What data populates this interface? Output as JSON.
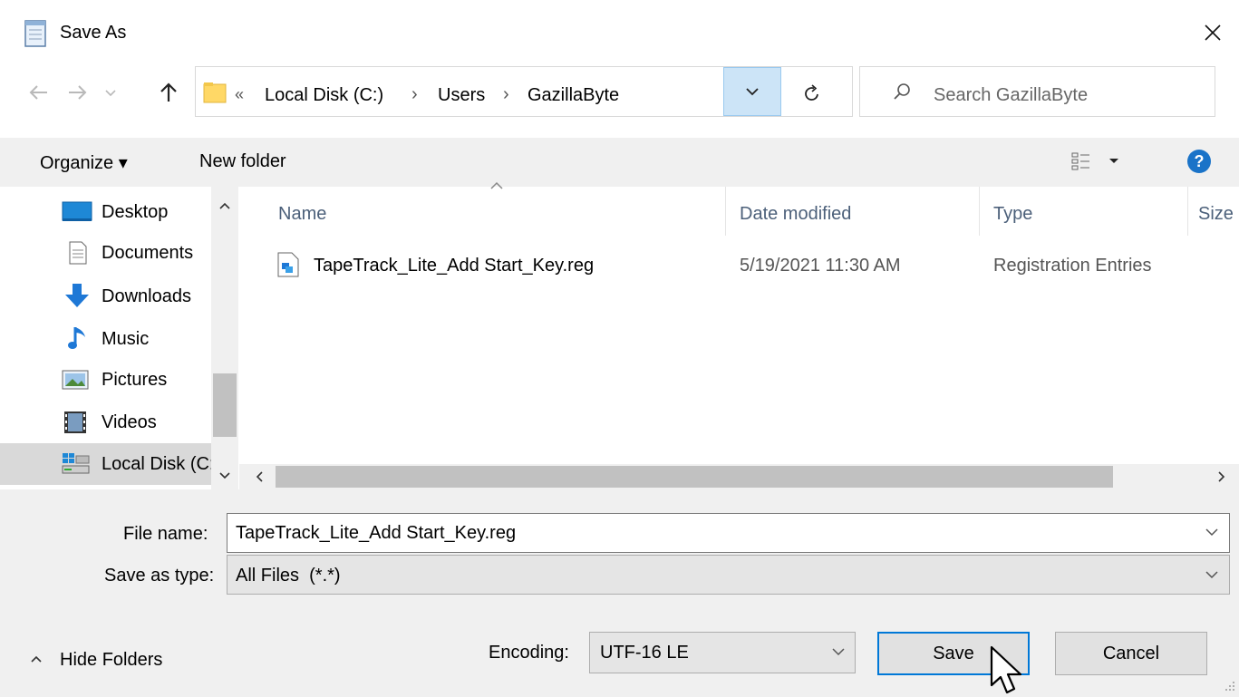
{
  "window": {
    "title": "Save As",
    "close_glyph": "✕"
  },
  "nav": {
    "breadcrumb": [
      "Local Disk (C:)",
      "Users",
      "GazillaByte"
    ],
    "overflow_glyph": "«",
    "separator_glyph": "›",
    "search_placeholder": "Search GazillaByte"
  },
  "toolbar": {
    "organize": "Organize ▾",
    "new_folder": "New folder"
  },
  "sidebar": {
    "items": [
      {
        "label": "Desktop",
        "icon": "desktop-icon"
      },
      {
        "label": "Documents",
        "icon": "documents-icon"
      },
      {
        "label": "Downloads",
        "icon": "downloads-icon"
      },
      {
        "label": "Music",
        "icon": "music-icon"
      },
      {
        "label": "Pictures",
        "icon": "pictures-icon"
      },
      {
        "label": "Videos",
        "icon": "videos-icon"
      },
      {
        "label": "Local Disk (C:)",
        "icon": "drive-icon",
        "selected": true
      }
    ]
  },
  "filelist": {
    "columns": [
      "Name",
      "Date modified",
      "Type",
      "Size"
    ],
    "rows": [
      {
        "name": "TapeTrack_Lite_Add Start_Key.reg",
        "date": "5/19/2021 11:30 AM",
        "type": "Registration Entries",
        "size": ""
      }
    ]
  },
  "form": {
    "filename_label": "File name:",
    "filename_value": "TapeTrack_Lite_Add Start_Key.reg",
    "type_label": "Save as type:",
    "type_value": "All Files  (*.*)",
    "encoding_label": "Encoding:",
    "encoding_value": "UTF-16 LE",
    "save": "Save",
    "cancel": "Cancel",
    "hide_folders": "Hide Folders"
  },
  "colors": {
    "accent": "#0078d7",
    "selected_bg": "#cce4f7",
    "header_text": "#4c607a"
  }
}
